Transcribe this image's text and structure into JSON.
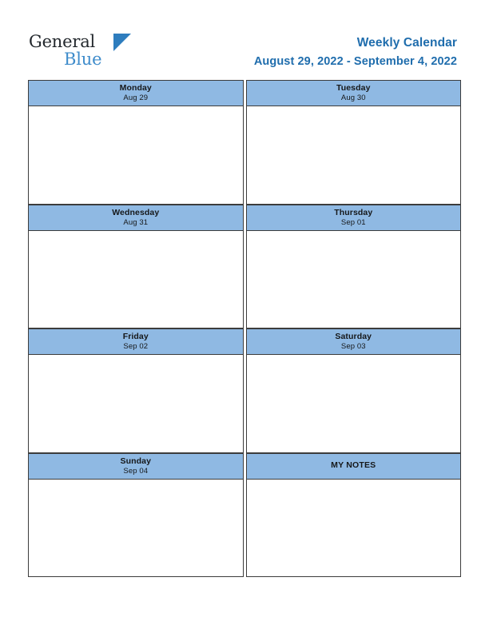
{
  "brand": {
    "name_part1": "General",
    "name_part2": "Blue",
    "triangle_color": "#2e7dbe",
    "accent_color": "#1f6dad"
  },
  "header": {
    "title": "Weekly Calendar",
    "date_range": "August 29, 2022 - September 4, 2022"
  },
  "calendar": {
    "header_bg": "#8fb9e3",
    "cells": [
      {
        "day": "Monday",
        "date": "Aug 29",
        "note": ""
      },
      {
        "day": "Tuesday",
        "date": "Aug 30",
        "note": ""
      },
      {
        "day": "Wednesday",
        "date": "Aug 31",
        "note": ""
      },
      {
        "day": "Thursday",
        "date": "Sep 01",
        "note": ""
      },
      {
        "day": "Friday",
        "date": "Sep 02",
        "note": ""
      },
      {
        "day": "Saturday",
        "date": "Sep 03",
        "note": ""
      },
      {
        "day": "Sunday",
        "date": "Sep 04",
        "note": ""
      },
      {
        "day": "MY NOTES",
        "date": "",
        "note": ""
      }
    ]
  }
}
